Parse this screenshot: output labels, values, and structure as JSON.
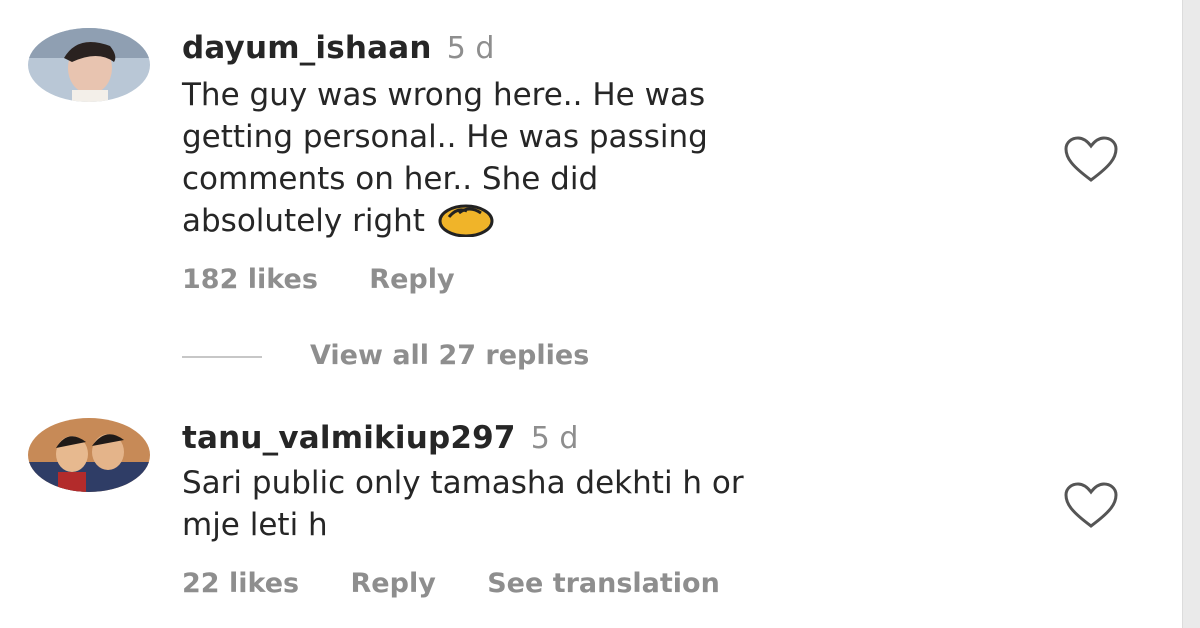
{
  "comments": [
    {
      "username": "dayum_ishaan",
      "time": "5 d",
      "text": "The guy was wrong here.. He was\ngetting personal.. He was passing\ncomments on her.. She did\nabsolutely right",
      "emoji": "clapping-hands-emoji",
      "likes": "182 likes",
      "reply_label": "Reply",
      "view_replies": "View all 27 replies"
    },
    {
      "username": "tanu_valmikiup297",
      "time": "5 d",
      "text": "Sari public only tamasha dekhti h or\nmje leti h",
      "likes": "22 likes",
      "reply_label": "Reply",
      "translate_label": "See translation"
    }
  ],
  "colors": {
    "text": "#262626",
    "secondary": "#8e8e8e",
    "background": "#ffffff"
  }
}
